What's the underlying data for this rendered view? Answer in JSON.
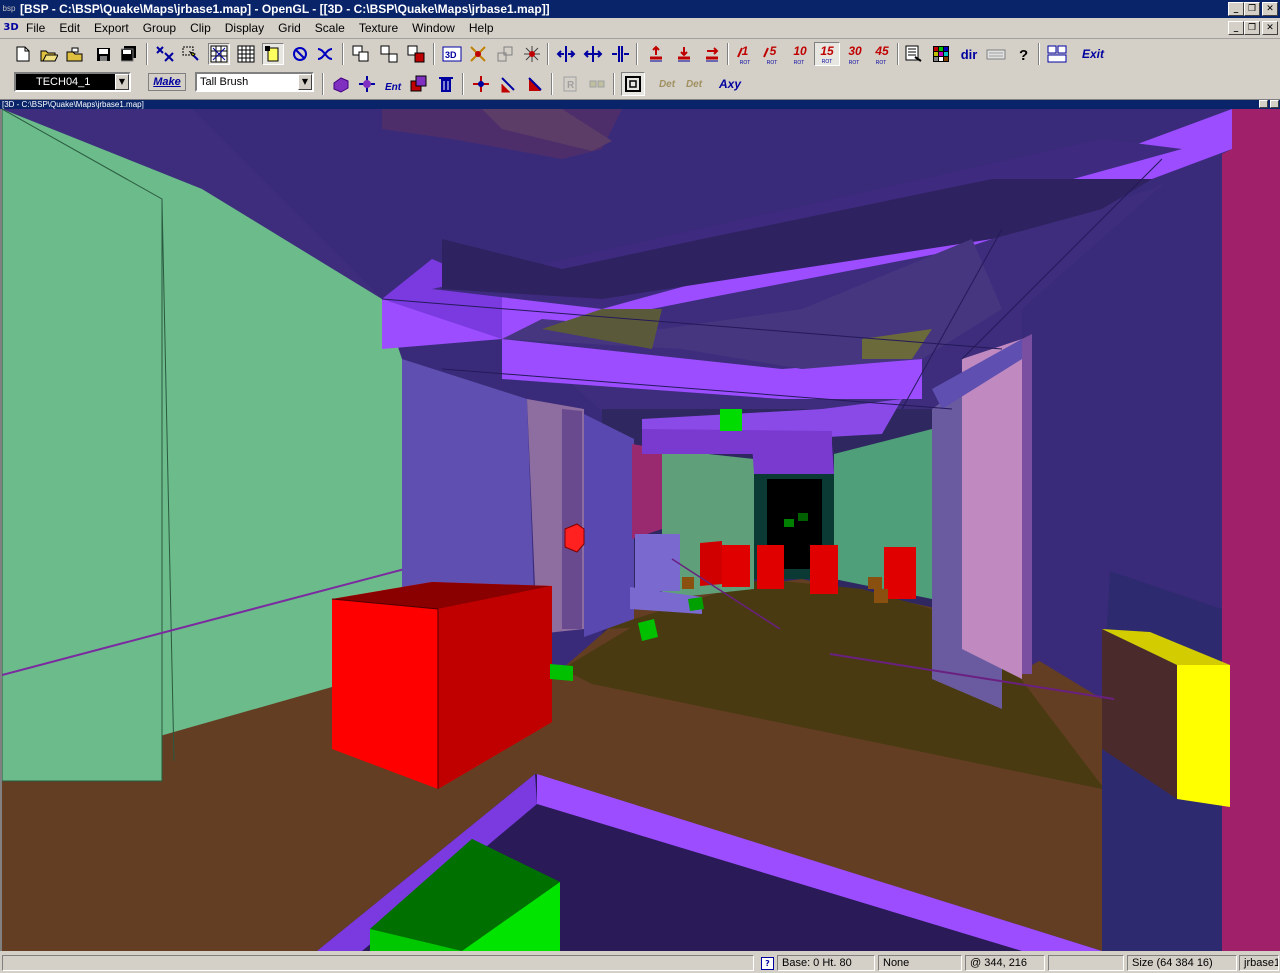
{
  "window": {
    "app_icon": "bsp",
    "title": "[BSP - C:\\BSP\\Quake\\Maps\\jrbase1.map] - OpenGL - [[3D - C:\\BSP\\Quake\\Maps\\jrbase1.map]]"
  },
  "menubar": {
    "doc_icon": "3D",
    "items": [
      {
        "label": "File"
      },
      {
        "label": "Edit"
      },
      {
        "label": "Export"
      },
      {
        "label": "Group"
      },
      {
        "label": "Clip"
      },
      {
        "label": "Display"
      },
      {
        "label": "Grid"
      },
      {
        "label": "Scale"
      },
      {
        "label": "Texture"
      },
      {
        "label": "Window"
      },
      {
        "label": "Help"
      }
    ]
  },
  "toolbar1": {
    "rotate_labels": [
      "1",
      "5",
      "10",
      "15",
      "30",
      "45"
    ],
    "rotate_sub": "ROT",
    "dir_label": "dir",
    "exit_label": "Exit"
  },
  "toolbar2": {
    "texture_value": "TECH04_1",
    "make_label": "Make",
    "brush_value": "Tall Brush",
    "det_label": "Det",
    "axy_label": "Axy"
  },
  "child_window": {
    "title": "[3D - C:\\BSP\\Quake\\Maps\\jrbase1.map]"
  },
  "statusbar": {
    "base": "Base: 0 Ht. 80",
    "mode": "None",
    "coords": "@  344,  216",
    "size": "Size (64 384 16)",
    "map": "jrbase1"
  },
  "colors": {
    "title_bar": "#0a246a",
    "ui_face": "#d4d0c8",
    "wall_green": "#6cbb8a",
    "ceiling_purple": "#3a2b7a",
    "beam_violet": "#9b4dff",
    "floor_brown": "#633e22",
    "entity_red": "#ff0000",
    "entity_green": "#00e400",
    "entity_yellow": "#ffff00"
  }
}
